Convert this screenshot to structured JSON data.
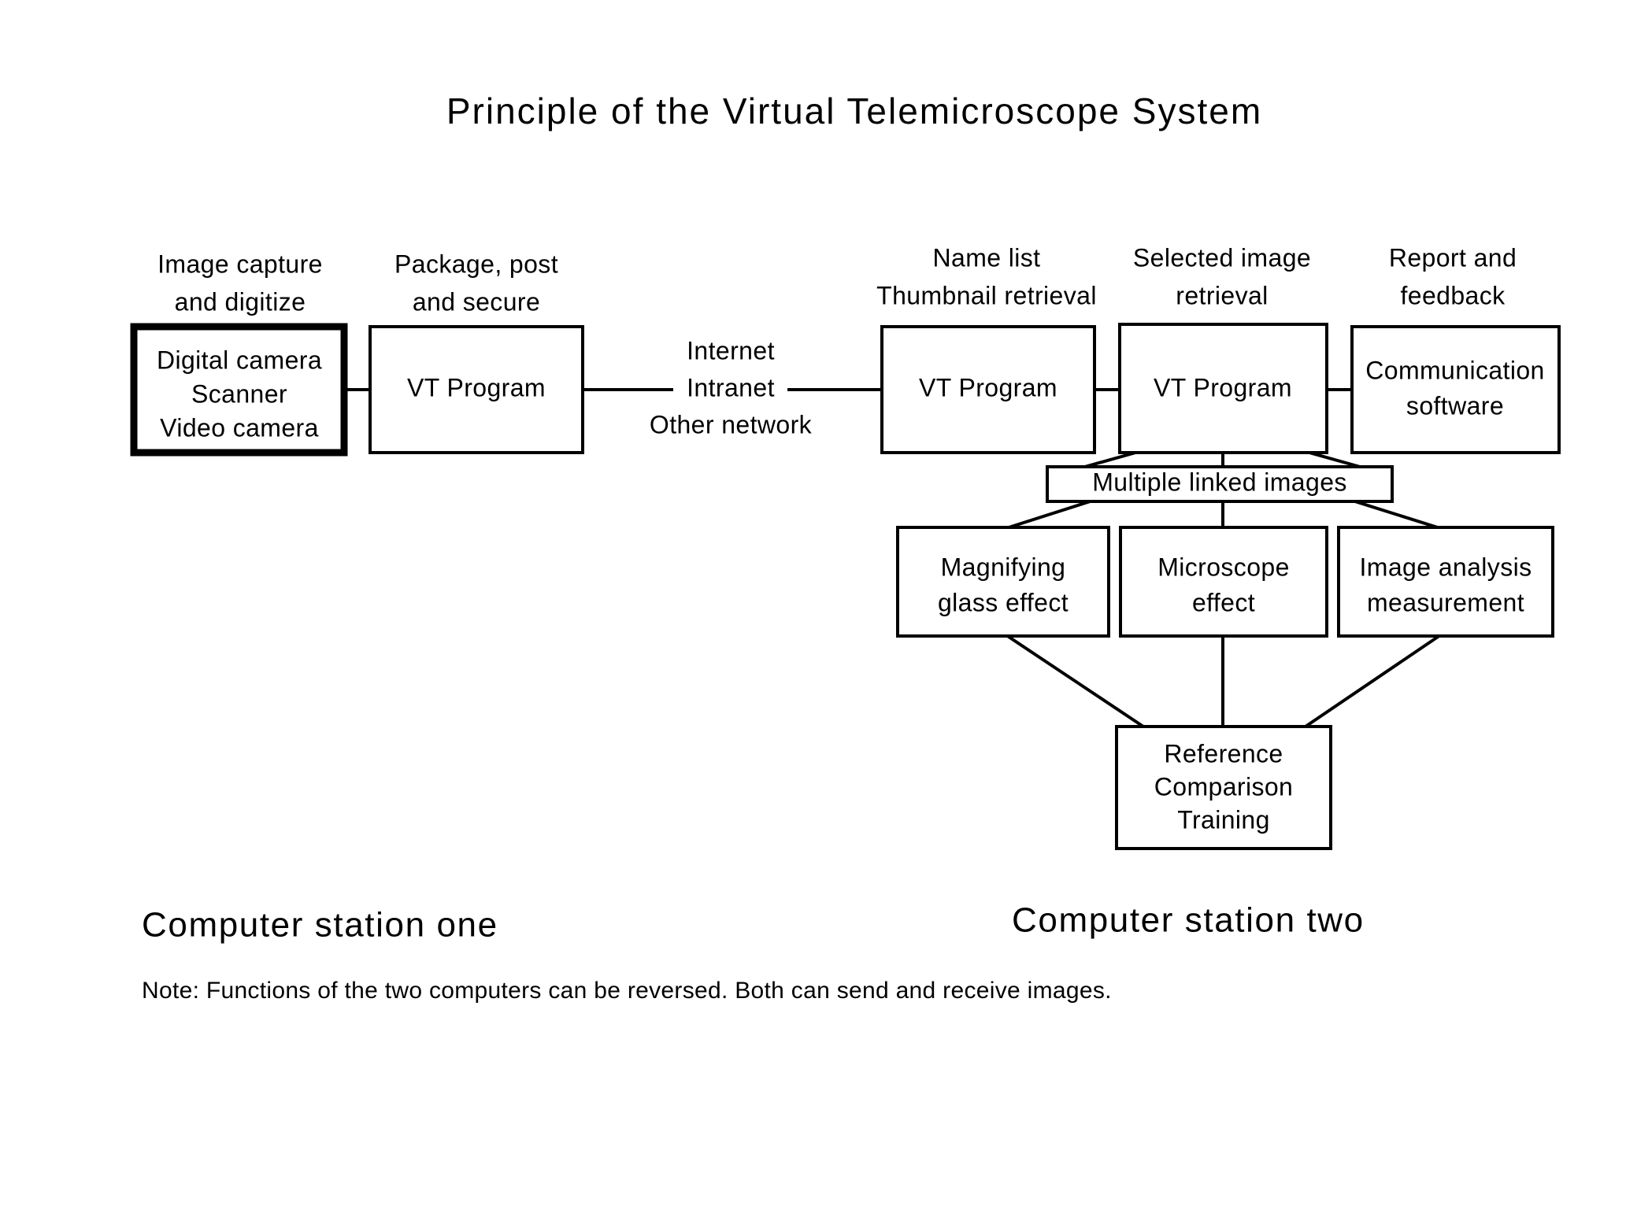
{
  "title": "Principle of the Virtual Telemicroscope System",
  "headers": {
    "image_capture": "Image capture\nand digitize",
    "image_capture_l1": "Image capture",
    "image_capture_l2": "and digitize",
    "package_post_l1": "Package, post",
    "package_post_l2": "and secure",
    "name_list_l1": "Name list",
    "name_list_l2": "Thumbnail retrieval",
    "selected_image_l1": "Selected image",
    "selected_image_l2": "retrieval",
    "report_feedback_l1": "Report and",
    "report_feedback_l2": "feedback"
  },
  "network": {
    "line1": "Internet",
    "line2": "Intranet",
    "line3": "Other network"
  },
  "boxes": {
    "capture_device_l1": "Digital camera",
    "capture_device_l2": "Scanner",
    "capture_device_l3": "Video camera",
    "vt_program_send": "VT Program",
    "vt_program_recv_1": "VT Program",
    "vt_program_recv_2": "VT Program",
    "communication_l1": "Communication",
    "communication_l2": "software",
    "multiple_linked_images": "Multiple linked images",
    "magnifying_l1": "Magnifying",
    "magnifying_l2": "glass effect",
    "microscope_l1": "Microscope",
    "microscope_l2": "effect",
    "image_analysis_l1": "Image analysis",
    "image_analysis_l2": "measurement",
    "reference_l1": "Reference",
    "reference_l2": "Comparison",
    "reference_l3": "Training"
  },
  "stations": {
    "station_one": "Computer station one",
    "station_two": "Computer station two"
  },
  "note": "Note: Functions of the two computers can be reversed. Both can send and receive images.",
  "colors": {
    "ink": "#000000",
    "paper": "#ffffff"
  }
}
